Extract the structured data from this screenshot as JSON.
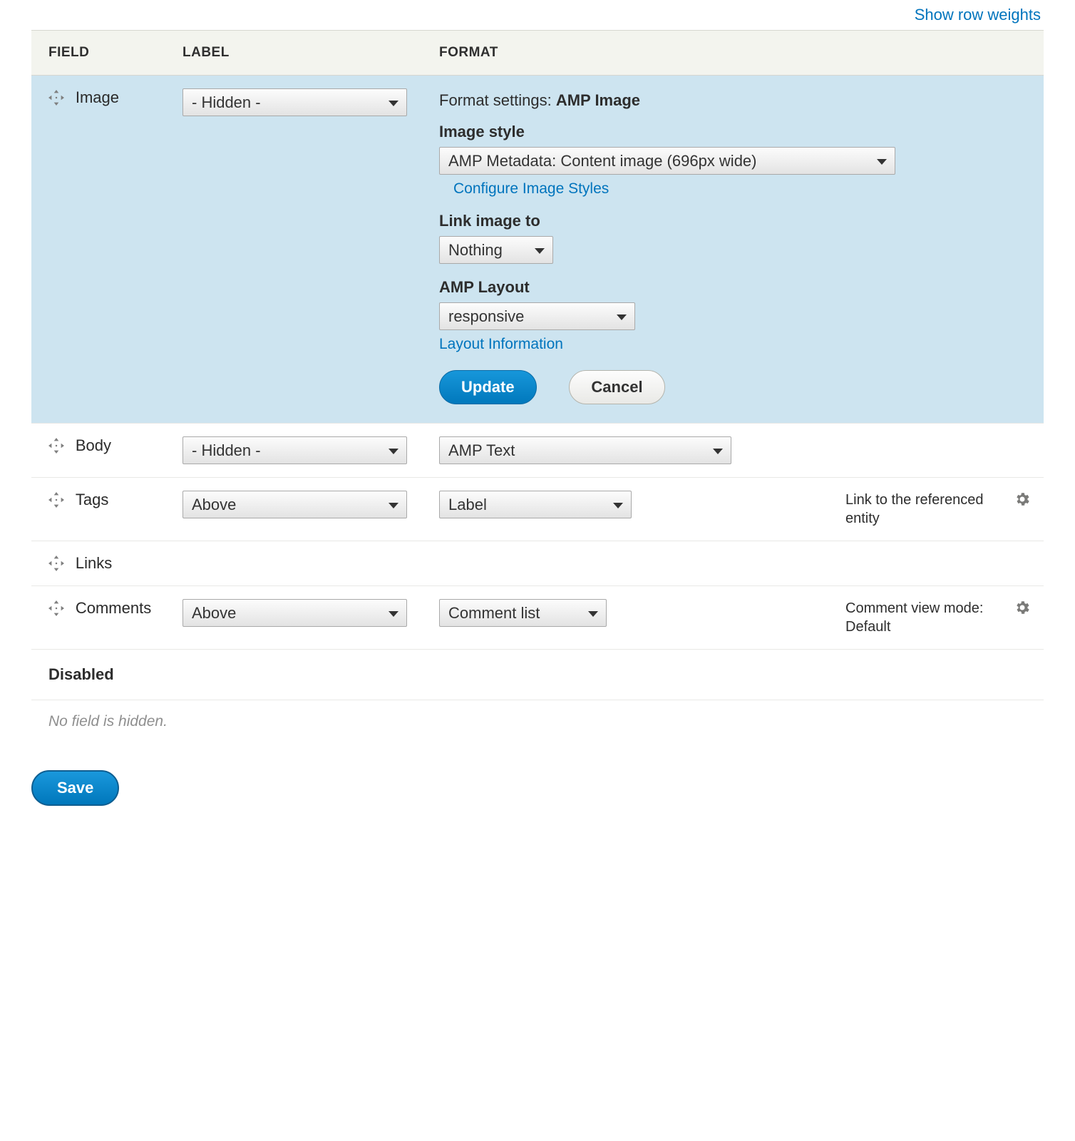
{
  "toolbar": {
    "show_row_weights": "Show row weights"
  },
  "headers": {
    "field": "FIELD",
    "label": "LABEL",
    "format": "FORMAT"
  },
  "rows": {
    "image": {
      "name": "Image",
      "label_select": "- Hidden -",
      "format_heading_prefix": "Format settings: ",
      "format_heading_value": "AMP Image",
      "image_style_label": "Image style",
      "image_style_value": "AMP Metadata: Content image (696px wide)",
      "configure_link": "Configure Image Styles",
      "link_image_label": "Link image to",
      "link_image_value": "Nothing",
      "amp_layout_label": "AMP Layout",
      "amp_layout_value": "responsive",
      "layout_info_link": "Layout Information",
      "update_btn": "Update",
      "cancel_btn": "Cancel"
    },
    "body": {
      "name": "Body",
      "label_select": "- Hidden -",
      "format_select": "AMP Text"
    },
    "tags": {
      "name": "Tags",
      "label_select": "Above",
      "format_select": "Label",
      "summary": "Link to the referenced entity"
    },
    "links": {
      "name": "Links"
    },
    "comments": {
      "name": "Comments",
      "label_select": "Above",
      "format_select": "Comment list",
      "summary": "Comment view mode: Default"
    }
  },
  "disabled": {
    "heading": "Disabled",
    "empty": "No field is hidden."
  },
  "save_btn": "Save"
}
